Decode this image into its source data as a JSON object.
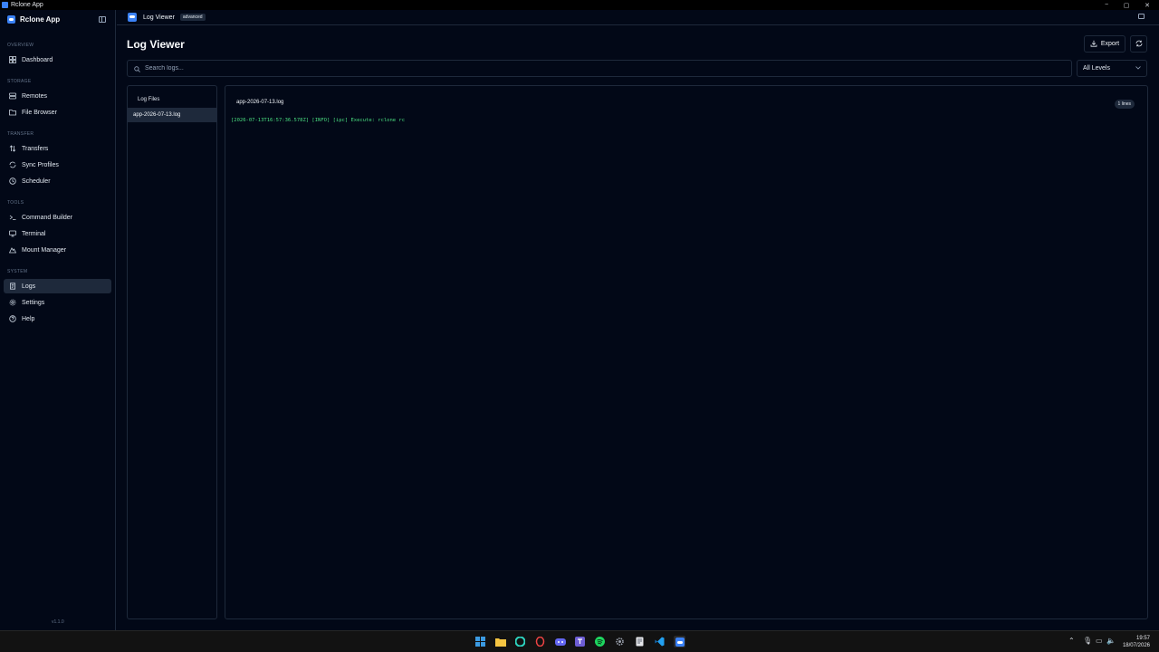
{
  "window": {
    "title": "Rclone App",
    "minimize": "−",
    "maximize": "▢",
    "close": "✕"
  },
  "sidebar": {
    "brand": "Rclone App",
    "sections": [
      {
        "label": "OVERVIEW",
        "items": [
          {
            "label": "Dashboard",
            "icon": "dashboard-icon"
          }
        ]
      },
      {
        "label": "STORAGE",
        "items": [
          {
            "label": "Remotes",
            "icon": "server-icon"
          },
          {
            "label": "File Browser",
            "icon": "folder-icon"
          }
        ]
      },
      {
        "label": "TRANSFER",
        "items": [
          {
            "label": "Transfers",
            "icon": "arrows-updown-icon"
          },
          {
            "label": "Sync Profiles",
            "icon": "sync-icon"
          },
          {
            "label": "Scheduler",
            "icon": "clock-icon"
          }
        ]
      },
      {
        "label": "TOOLS",
        "items": [
          {
            "label": "Command Builder",
            "icon": "terminal-prompt-icon"
          },
          {
            "label": "Terminal",
            "icon": "monitor-icon"
          },
          {
            "label": "Mount Manager",
            "icon": "mountain-icon"
          }
        ]
      },
      {
        "label": "SYSTEM",
        "items": [
          {
            "label": "Logs",
            "icon": "scroll-icon",
            "active": true
          },
          {
            "label": "Settings",
            "icon": "gear-icon"
          },
          {
            "label": "Help",
            "icon": "help-circle-icon"
          }
        ]
      }
    ],
    "version": "v1.1.0"
  },
  "topbar": {
    "title": "Log Viewer",
    "badge": "advanced"
  },
  "page": {
    "title": "Log Viewer",
    "export_label": "Export",
    "search_placeholder": "Search logs...",
    "level_filter": "All Levels"
  },
  "files": {
    "title": "Log Files",
    "items": [
      "app-2026-07-13.log"
    ]
  },
  "viewer": {
    "filename": "app-2026-07-13.log",
    "line_count": "1 lines",
    "lines": [
      "[2026-07-13T16:57:36.578Z] [INFO] [ipc] Execute: rclone rc"
    ]
  },
  "taskbar": {
    "time": "19:57",
    "date": "18/07/2026"
  },
  "colors": {
    "accent": "#3b82f6",
    "log_text": "#4ade80",
    "background": "#020817"
  }
}
